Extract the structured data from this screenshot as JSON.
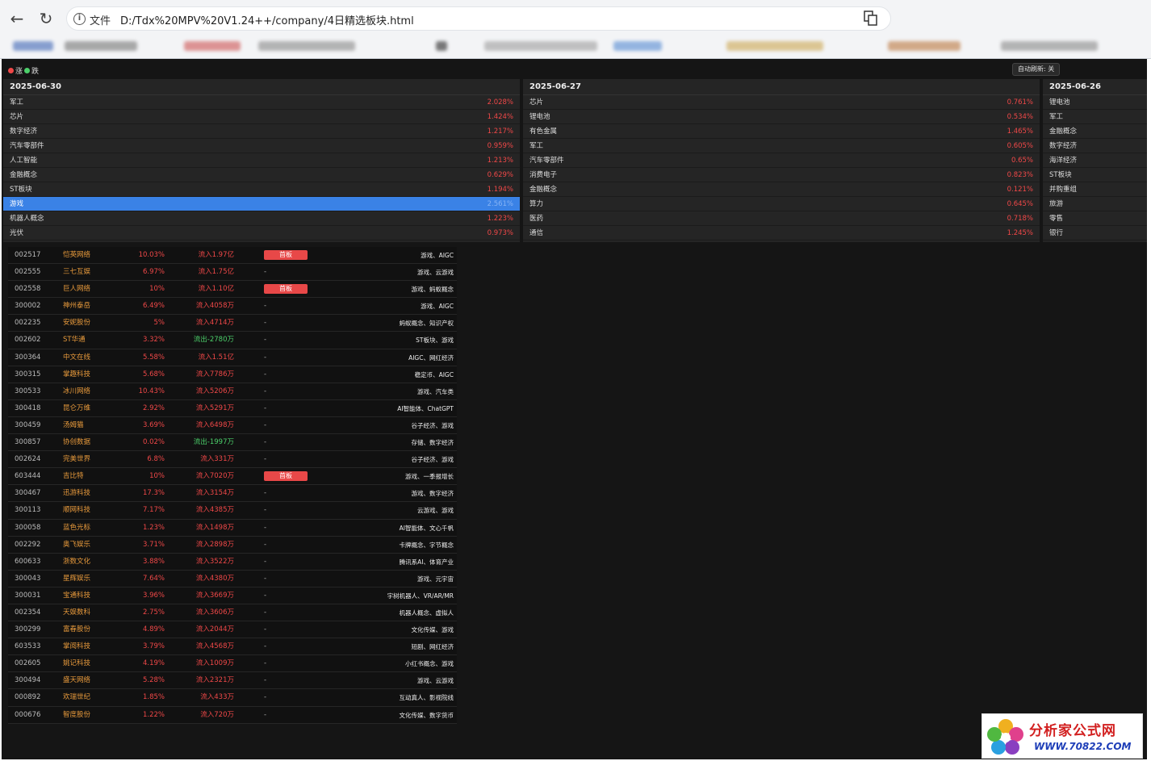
{
  "browser": {
    "scheme_label": "文件",
    "url": "D:/Tdx%20MPV%20V1.24++/company/4日精选板块.html"
  },
  "legend": {
    "up": "涨",
    "down": "跌",
    "up_color": "#f04848",
    "down_color": "#4ccf6a"
  },
  "auto_refresh_label": "自动刷新: 关",
  "columns": [
    {
      "date": "2025-06-30",
      "rows": [
        {
          "name": "军工",
          "pct": "2.028%"
        },
        {
          "name": "芯片",
          "pct": "1.424%"
        },
        {
          "name": "数字经济",
          "pct": "1.217%"
        },
        {
          "name": "汽车零部件",
          "pct": "0.959%"
        },
        {
          "name": "人工智能",
          "pct": "1.213%"
        },
        {
          "name": "金融概念",
          "pct": "0.629%"
        },
        {
          "name": "ST板块",
          "pct": "1.194%"
        },
        {
          "name": "游戏",
          "pct": "2.561%"
        },
        {
          "name": "机器人概念",
          "pct": "1.223%"
        },
        {
          "name": "光伏",
          "pct": "0.973%"
        }
      ]
    },
    {
      "date": "2025-06-27",
      "rows": [
        {
          "name": "芯片",
          "pct": "0.761%"
        },
        {
          "name": "锂电池",
          "pct": "0.534%"
        },
        {
          "name": "有色金属",
          "pct": "1.465%"
        },
        {
          "name": "军工",
          "pct": "0.605%"
        },
        {
          "name": "汽车零部件",
          "pct": "0.65%"
        },
        {
          "name": "消费电子",
          "pct": "0.823%"
        },
        {
          "name": "金融概念",
          "pct": "0.121%"
        },
        {
          "name": "算力",
          "pct": "0.645%"
        },
        {
          "name": "医药",
          "pct": "0.718%"
        },
        {
          "name": "通信",
          "pct": "1.245%"
        }
      ]
    },
    {
      "date": "2025-06-26",
      "rows": [
        {
          "name": "锂电池",
          "pct": ""
        },
        {
          "name": "军工",
          "pct": ""
        },
        {
          "name": "金融概念",
          "pct": ""
        },
        {
          "name": "数字经济",
          "pct": ""
        },
        {
          "name": "海洋经济",
          "pct": ""
        },
        {
          "name": "ST板块",
          "pct": ""
        },
        {
          "name": "并购重组",
          "pct": ""
        },
        {
          "name": "旅游",
          "pct": ""
        },
        {
          "name": "零售",
          "pct": ""
        },
        {
          "name": "银行",
          "pct": ""
        }
      ]
    }
  ],
  "stocks": [
    {
      "code": "002517",
      "name": "恺英网络",
      "pct": "10.03%",
      "flow": "流入1.97亿",
      "tag": "首板",
      "concepts": "游戏、AIGC"
    },
    {
      "code": "002555",
      "name": "三七互娱",
      "pct": "6.97%",
      "flow": "流入1.75亿",
      "tag": "-",
      "concepts": "游戏、云游戏"
    },
    {
      "code": "002558",
      "name": "巨人网络",
      "pct": "10%",
      "flow": "流入1.10亿",
      "tag": "首板",
      "concepts": "游戏、蚂蚁概念"
    },
    {
      "code": "300002",
      "name": "神州泰岳",
      "pct": "6.49%",
      "flow": "流入4058万",
      "tag": "-",
      "concepts": "游戏、AIGC"
    },
    {
      "code": "002235",
      "name": "安妮股份",
      "pct": "5%",
      "flow": "流入4714万",
      "tag": "-",
      "concepts": "蚂蚁概念、知识产权"
    },
    {
      "code": "002602",
      "name": "ST华通",
      "pct": "3.32%",
      "flow": "流出-2780万",
      "tag": "-",
      "concepts": "ST板块、游戏"
    },
    {
      "code": "300364",
      "name": "中文在线",
      "pct": "5.58%",
      "flow": "流入1.51亿",
      "tag": "-",
      "concepts": "AIGC、网红经济"
    },
    {
      "code": "300315",
      "name": "掌趣科技",
      "pct": "5.68%",
      "flow": "流入7786万",
      "tag": "-",
      "concepts": "稳定币、AIGC"
    },
    {
      "code": "300533",
      "name": "冰川网络",
      "pct": "10.43%",
      "flow": "流入5206万",
      "tag": "-",
      "concepts": "游戏、汽车类"
    },
    {
      "code": "300418",
      "name": "昆仑万维",
      "pct": "2.92%",
      "flow": "流入5291万",
      "tag": "-",
      "concepts": "AI智能体、ChatGPT"
    },
    {
      "code": "300459",
      "name": "汤姆猫",
      "pct": "3.69%",
      "flow": "流入6498万",
      "tag": "-",
      "concepts": "谷子经济、游戏"
    },
    {
      "code": "300857",
      "name": "协创数据",
      "pct": "0.02%",
      "flow": "流出-1997万",
      "tag": "-",
      "concepts": "存储、数字经济"
    },
    {
      "code": "002624",
      "name": "完美世界",
      "pct": "6.8%",
      "flow": "流入331万",
      "tag": "-",
      "concepts": "谷子经济、游戏"
    },
    {
      "code": "603444",
      "name": "吉比特",
      "pct": "10%",
      "flow": "流入7020万",
      "tag": "首板",
      "concepts": "游戏、一季报增长"
    },
    {
      "code": "300467",
      "name": "迅游科技",
      "pct": "17.3%",
      "flow": "流入3154万",
      "tag": "-",
      "concepts": "游戏、数字经济"
    },
    {
      "code": "300113",
      "name": "顺网科技",
      "pct": "7.17%",
      "flow": "流入4385万",
      "tag": "-",
      "concepts": "云游戏、游戏"
    },
    {
      "code": "300058",
      "name": "蓝色光标",
      "pct": "1.23%",
      "flow": "流入1498万",
      "tag": "-",
      "concepts": "AI智能体、文心千帆"
    },
    {
      "code": "002292",
      "name": "奥飞娱乐",
      "pct": "3.71%",
      "flow": "流入2898万",
      "tag": "-",
      "concepts": "卡牌概念、字节概念"
    },
    {
      "code": "600633",
      "name": "浙数文化",
      "pct": "3.88%",
      "flow": "流入3522万",
      "tag": "-",
      "concepts": "腾讯系AI、体育产业"
    },
    {
      "code": "300043",
      "name": "星辉娱乐",
      "pct": "7.64%",
      "flow": "流入4380万",
      "tag": "-",
      "concepts": "游戏、元宇宙"
    },
    {
      "code": "300031",
      "name": "宝通科技",
      "pct": "3.96%",
      "flow": "流入3669万",
      "tag": "-",
      "concepts": "宇树机器人、VR/AR/MR"
    },
    {
      "code": "002354",
      "name": "天娱数科",
      "pct": "2.75%",
      "flow": "流入3606万",
      "tag": "-",
      "concepts": "机器人概念、虚拟人"
    },
    {
      "code": "300299",
      "name": "富春股份",
      "pct": "4.89%",
      "flow": "流入2044万",
      "tag": "-",
      "concepts": "文化传媒、游戏"
    },
    {
      "code": "603533",
      "name": "掌阅科技",
      "pct": "3.79%",
      "flow": "流入4568万",
      "tag": "-",
      "concepts": "短剧、网红经济"
    },
    {
      "code": "002605",
      "name": "姚记科技",
      "pct": "4.19%",
      "flow": "流入1009万",
      "tag": "-",
      "concepts": "小红书概念、游戏"
    },
    {
      "code": "300494",
      "name": "盛天网络",
      "pct": "5.28%",
      "flow": "流入2321万",
      "tag": "-",
      "concepts": "游戏、云游戏"
    },
    {
      "code": "000892",
      "name": "欢瑞世纪",
      "pct": "1.85%",
      "flow": "流入433万",
      "tag": "-",
      "concepts": "互动真人、影视院线"
    },
    {
      "code": "000676",
      "name": "智度股份",
      "pct": "1.22%",
      "flow": "流入720万",
      "tag": "-",
      "concepts": "文化传媒、数字货币"
    }
  ],
  "watermark": {
    "name": "分析家公式网",
    "site": "WWW.70822.COM"
  }
}
